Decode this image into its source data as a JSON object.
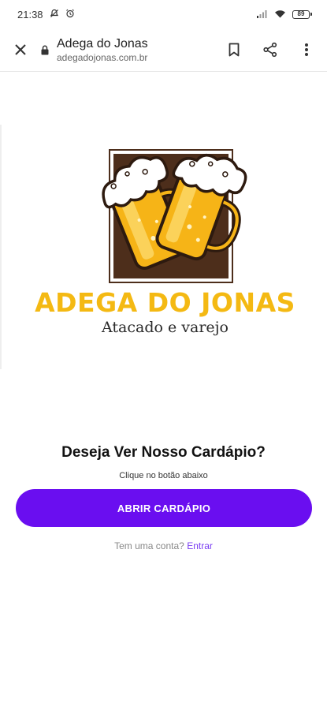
{
  "status_bar": {
    "time": "21:38",
    "battery": "89"
  },
  "browser": {
    "page_title": "Adega do Jonas",
    "url": "adegadojonas.com.br"
  },
  "brand": {
    "name": "ADEGA DO JONAS",
    "tagline": "Atacado e varejo"
  },
  "cta": {
    "title": "Deseja Ver Nosso Cardápio?",
    "subtitle": "Clique no botão abaixo",
    "button_label": "ABRIR CARDÁPIO"
  },
  "login": {
    "prompt": "Tem uma conta?",
    "link_label": "Entrar"
  },
  "colors": {
    "accent": "#6a0ef0",
    "brand_yellow": "#f4b913",
    "logo_brown": "#4d2e1b"
  }
}
